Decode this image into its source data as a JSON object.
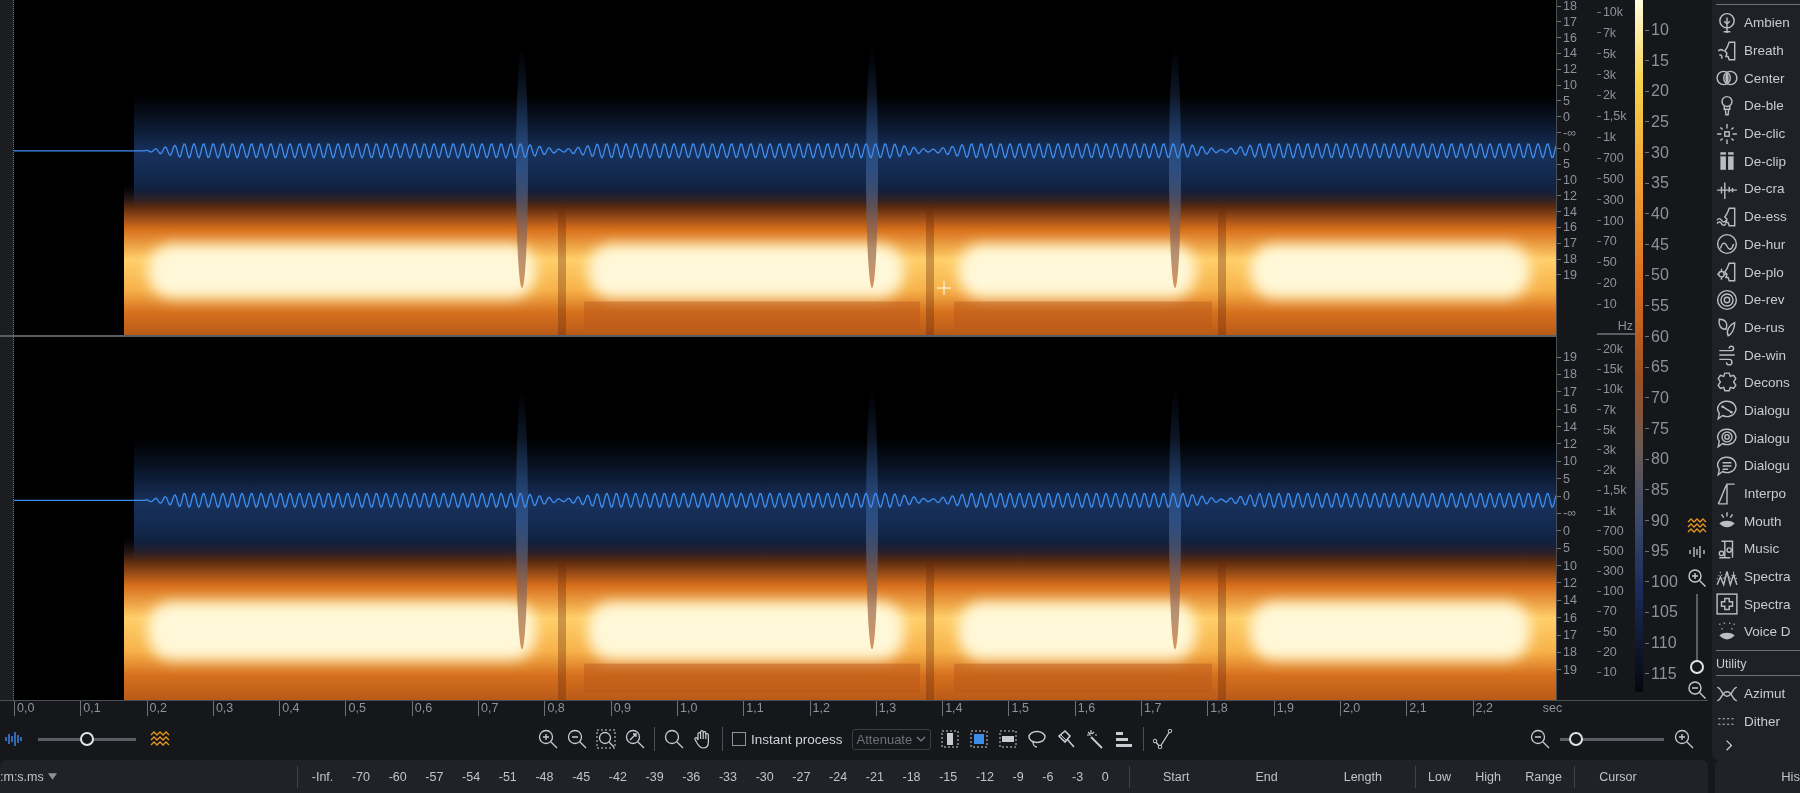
{
  "channels": [
    {
      "amplitude_labels": [
        "18",
        "17",
        "16",
        "14",
        "12",
        "10",
        "5",
        "0",
        "-∞",
        "0",
        "5",
        "10",
        "12",
        "14",
        "16",
        "17",
        "18",
        "19"
      ],
      "frequency_labels": [
        "10k",
        "7k",
        "5k",
        "3k",
        "2k",
        "1,5k",
        "1k",
        "700",
        "500",
        "300",
        "100",
        "70",
        "50",
        "20",
        "10"
      ],
      "cursor_visible": true
    },
    {
      "amplitude_labels": [
        "19",
        "18",
        "17",
        "16",
        "14",
        "12",
        "10",
        "5",
        "0",
        "-∞",
        "0",
        "5",
        "10",
        "12",
        "14",
        "16",
        "17",
        "18",
        "19"
      ],
      "frequency_labels": [
        "20k",
        "15k",
        "10k",
        "7k",
        "5k",
        "3k",
        "2k",
        "1,5k",
        "1k",
        "700",
        "500",
        "300",
        "100",
        "70",
        "50",
        "20",
        "10"
      ],
      "cursor_visible": false
    }
  ],
  "frequency_unit": "Hz",
  "colorbar_labels": [
    "10",
    "15",
    "20",
    "25",
    "30",
    "35",
    "40",
    "45",
    "50",
    "55",
    "60",
    "65",
    "70",
    "75",
    "80",
    "85",
    "90",
    "95",
    "100",
    "105",
    "110",
    "115"
  ],
  "vertical_zoom": {
    "level": 0
  },
  "time_ruler": {
    "labels": [
      "0,0",
      "0,1",
      "0,2",
      "0,3",
      "0,4",
      "0,5",
      "0,6",
      "0,7",
      "0,8",
      "0,9",
      "1,0",
      "1,1",
      "1,2",
      "1,3",
      "1,4",
      "1,5",
      "1,6",
      "1,7",
      "1,8",
      "1,9",
      "2,0",
      "2,1",
      "2,2"
    ],
    "unit": "sec"
  },
  "toolbar": {
    "blend_slider": {
      "level": 0.5
    },
    "instant_process": {
      "label": "Instant process",
      "checked": false
    },
    "mode_dropdown": {
      "value": "Attenuate"
    },
    "selection_tools": [
      {
        "kind": "time",
        "selected": false
      },
      {
        "kind": "time_frequency",
        "selected": true
      },
      {
        "kind": "frequency",
        "selected": false
      },
      {
        "kind": "lasso",
        "selected": false
      },
      {
        "kind": "brush",
        "selected": false
      },
      {
        "kind": "wand",
        "selected": false
      },
      {
        "kind": "harmonic",
        "selected": false
      }
    ],
    "zoom_slider": {
      "level": 0.1
    }
  },
  "modules": {
    "sections": [
      {
        "items": [
          "Ambien",
          "Breath",
          "Center",
          "De-ble",
          "De-clic",
          "De-clip",
          "De-cra",
          "De-ess",
          "De-hur",
          "De-plo",
          "De-rev",
          "De-rus",
          "De-win",
          "Decons",
          "Dialogu",
          "Dialogu",
          "Dialogu",
          "Interpo",
          "Mouth",
          "Music",
          "Spectra",
          "Spectra",
          "Voice D"
        ]
      },
      {
        "title": "Utility",
        "items": [
          "Azimut",
          "Dither"
        ]
      }
    ]
  },
  "status_bar": {
    "time_format": ":m:s.ms",
    "meter_labels": [
      "-Inf.",
      "-70",
      "-60",
      "-57",
      "-54",
      "-51",
      "-48",
      "-45",
      "-42",
      "-39",
      "-36",
      "-33",
      "-30",
      "-27",
      "-24",
      "-21",
      "-18",
      "-15",
      "-12",
      "-9",
      "-6",
      "-3",
      "0"
    ],
    "selection_columns": [
      "Start",
      "End",
      "Length"
    ],
    "frequency_columns": [
      "Low",
      "High",
      "Range"
    ],
    "cursor_column": "Cursor"
  },
  "history": {
    "title": "His"
  }
}
